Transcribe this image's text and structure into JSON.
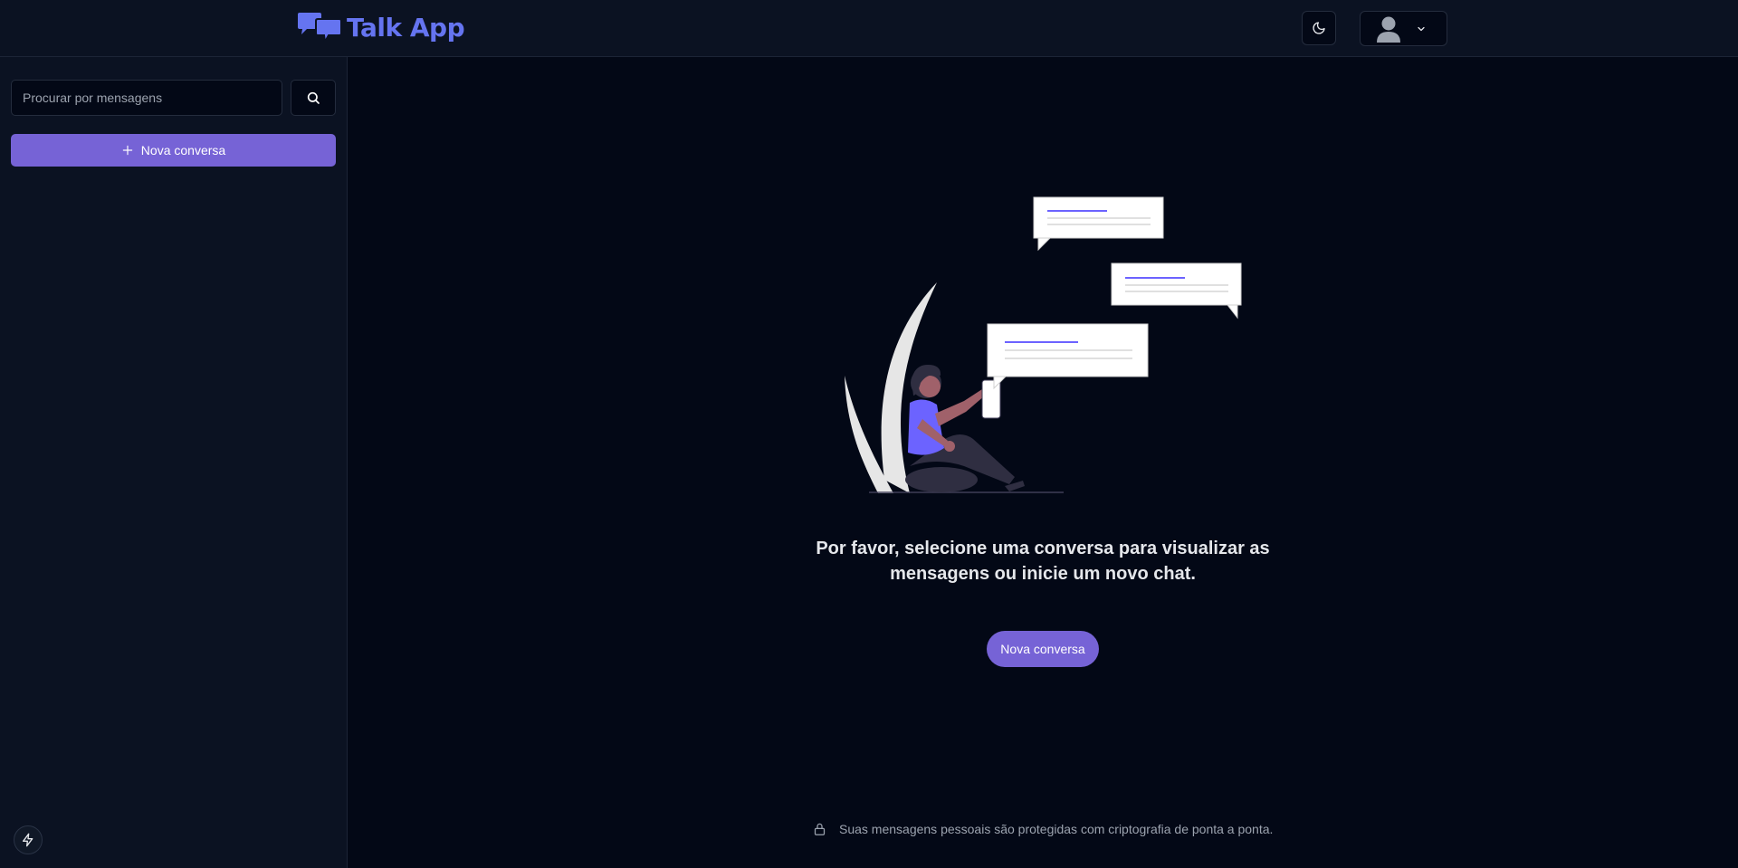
{
  "app": {
    "title": "Talk App"
  },
  "header": {
    "theme_icon": "moon-icon",
    "avatar_icon": "user-avatar-icon",
    "dropdown_icon": "chevron-down-icon"
  },
  "sidebar": {
    "search": {
      "placeholder": "Procurar por mensagens",
      "value": ""
    },
    "search_icon": "search-icon",
    "new_chat_label": "Nova conversa",
    "new_chat_icon": "plus-icon",
    "bolt_icon": "bolt-icon"
  },
  "main": {
    "prompt": "Por favor, selecione uma conversa para visualizar as mensagens ou inicie um novo chat.",
    "new_chat_label": "Nova conversa",
    "footer_note": "Suas mensagens pessoais são protegidas com criptografia de ponta a ponta.",
    "footer_icon": "lock-icon"
  },
  "colors": {
    "accent": "#7663d6",
    "logo": "#6574f0",
    "background": "#030816",
    "panel": "#0b1222"
  }
}
